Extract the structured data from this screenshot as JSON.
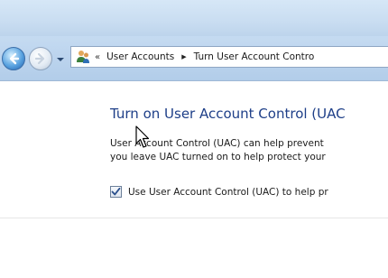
{
  "navigation": {
    "back_icon": "back-arrow-icon",
    "forward_icon": "forward-arrow-icon",
    "recent_pages_icon": "chevron-down-icon"
  },
  "address_bar": {
    "location_icon": "user-accounts-icon",
    "overflow_symbol": "«",
    "breadcrumbs": [
      "User Accounts",
      "Turn User Account Contro"
    ],
    "separator": "▶"
  },
  "main": {
    "heading": "Turn on User Account Control (UAC",
    "description_lines": [
      "User Account Control (UAC) can help prevent",
      "you leave UAC turned on to help protect your"
    ],
    "uac_checkbox": {
      "checked": true,
      "label": "Use User Account Control (UAC) to help pr"
    }
  },
  "colors": {
    "heading": "#1e3f88",
    "navbar": "#bcd4ee",
    "checkmark": "#2a4f8c"
  }
}
